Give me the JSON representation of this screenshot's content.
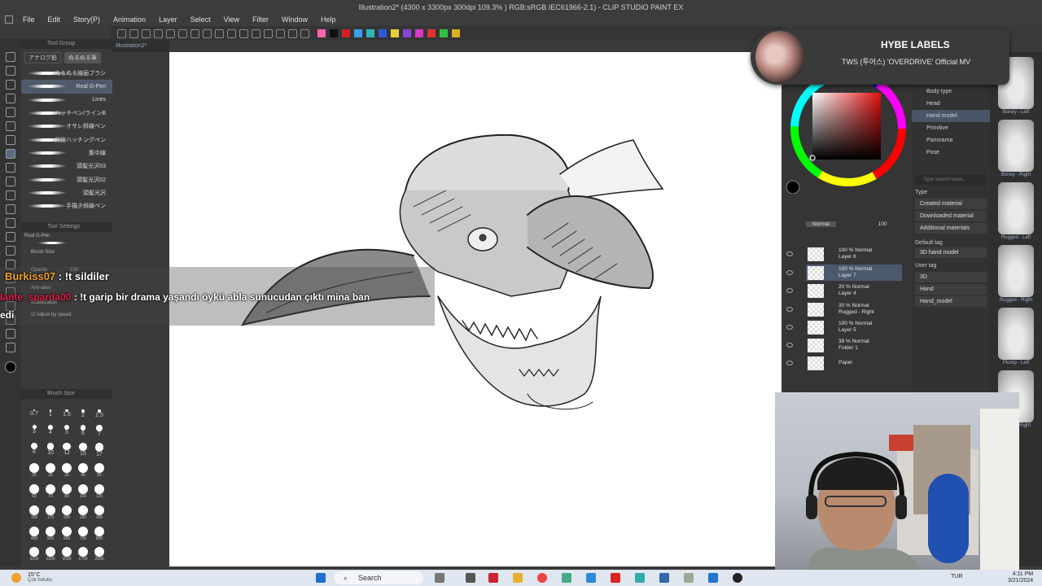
{
  "window": {
    "title": "Illustration2* (4300 x 3300px 300dpi 109.3% ) RGB:sRGB IEC61966-2.1) - CLIP STUDIO PAINT EX"
  },
  "menu": [
    "File",
    "Edit",
    "Story(P)",
    "Animation",
    "Layer",
    "Select",
    "View",
    "Filter",
    "Window",
    "Help"
  ],
  "canvas_tab": "Illustration2*",
  "command_bar_colors": [
    "#ff66aa",
    "#111111",
    "#cc2222",
    "#3aa0e8",
    "#2cb8b8",
    "#2c5ad8",
    "#e8d038",
    "#8844d8",
    "#d838c8",
    "#e03030",
    "#30c040",
    "#d8b020"
  ],
  "tool_panel": {
    "title": "Tool Group",
    "tabs": [
      "アナログ鉛",
      "ぬるぬる筆"
    ],
    "active_tab": 1,
    "brushes": [
      "ぬるぬる線画ブラシ",
      "Real G-Pen",
      "Lines",
      "ハッチペン/ラインB",
      "オサレ斜線ペン",
      "斜線ハッチングペン",
      "集中線",
      "頭髪光沢03",
      "頭髪光沢02",
      "頭髪光沢",
      "手描き斜線ペン"
    ],
    "selected_brush": 1,
    "tool_settings_title": "Tool Settings",
    "preview_label": "Real G-Pen",
    "brush_size_label": "Brush Size",
    "opacity_label": "Opacity",
    "opacity_value": "100",
    "antialias_label": "Anti-alias",
    "stabilization_label": "Stabilization",
    "adjust_label": "Adjust by speed"
  },
  "brush_size_panel": {
    "title": "Brush Size",
    "sizes": [
      "0.7",
      "1",
      "1.5",
      "2",
      "2.5",
      "3",
      "4",
      "5",
      "6",
      "7",
      "8",
      "10",
      "12",
      "15",
      "17",
      "20",
      "25",
      "30",
      "40",
      "50",
      "60",
      "70",
      "80",
      "100",
      "120",
      "150",
      "170",
      "200",
      "250",
      "300",
      "400",
      "500",
      "600",
      "700",
      "800",
      "1000",
      "1200",
      "1500",
      "1700",
      "2000"
    ]
  },
  "chat": [
    {
      "user": "Burkiss07",
      "message": ": !t sildiler"
    },
    {
      "user": "dante_sparda00",
      "message": ": !t garip bir drama yaşandı öykü abla sunucudan çıktı mina ban"
    },
    {
      "user": "",
      "message": "edi"
    }
  ],
  "notification": {
    "title": "HYBE LABELS",
    "subtitle": "TWS (투어스) 'OVERDRIVE' Official MV"
  },
  "material_panel": {
    "items": [
      "3D",
      "Body type",
      "Head",
      "Hand model",
      "Primitive",
      "Panorama",
      "Pose"
    ],
    "selected": "Hand model",
    "search_placeholder": "Type search keyw...",
    "type_label": "Type",
    "type_items": [
      "Created material",
      "Downloaded material",
      "Additional materials"
    ],
    "default_tag_label": "Default tag",
    "default_tag": "3D hand model",
    "user_tag_label": "User tag",
    "user_tags": [
      "3D",
      "Hand",
      "Hand_model"
    ]
  },
  "hand_thumbnails": [
    "Boney - Left",
    "Boney - Right",
    "Rugged - Left",
    "Rugged - Right",
    "Plump - Left",
    "Plump - Right"
  ],
  "layers": {
    "blend_mode": "Normal",
    "opacity": "100",
    "items": [
      {
        "line1": "100 % Normal",
        "line2": "Layer 6"
      },
      {
        "line1": "100 % Normal",
        "line2": "Layer 7"
      },
      {
        "line1": "20 % Normal",
        "line2": "Layer 4"
      },
      {
        "line1": "30 % Normal",
        "line2": "Rugged - Right"
      },
      {
        "line1": "100 % Normal",
        "line2": "Layer 5"
      },
      {
        "line1": "39 % Normal",
        "line2": "Folder 1"
      },
      {
        "line1": "",
        "line2": "Paper"
      }
    ],
    "selected": 1
  },
  "taskbar": {
    "weather_temp": "15°C",
    "weather_text": "Çok bulutlu",
    "search_label": "Search",
    "language": "TUR",
    "time": "4:11 PM",
    "date": "3/21/2024"
  }
}
